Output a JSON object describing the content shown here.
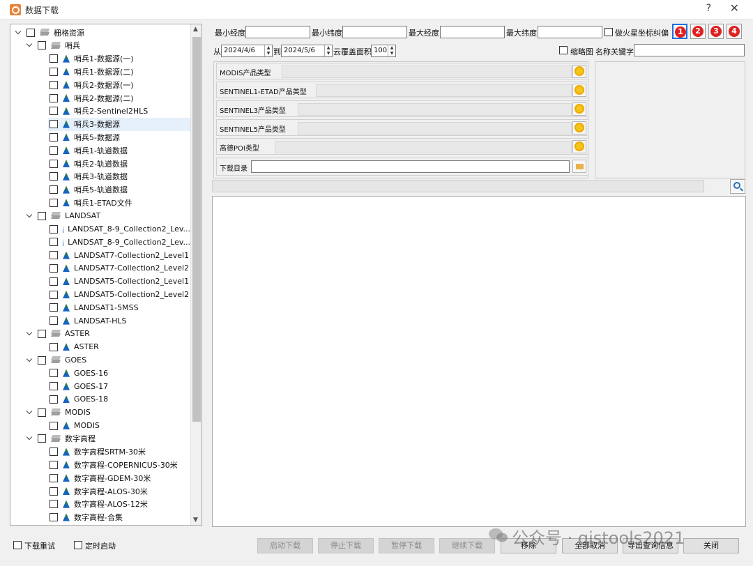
{
  "window": {
    "title": "数据下载",
    "help": "?",
    "close": "✕"
  },
  "tree": {
    "rows": [
      {
        "level": 0,
        "label": "栅格资源",
        "type": "group"
      },
      {
        "level": 1,
        "label": "哨兵",
        "type": "group"
      },
      {
        "level": 2,
        "label": "哨兵1-数据源(一)",
        "type": "leaf"
      },
      {
        "level": 2,
        "label": "哨兵1-数据源(二)",
        "type": "leaf"
      },
      {
        "level": 2,
        "label": "哨兵2-数据源(一)",
        "type": "leaf"
      },
      {
        "level": 2,
        "label": "哨兵2-数据源(二)",
        "type": "leaf"
      },
      {
        "level": 2,
        "label": "哨兵2-Sentinel2HLS",
        "type": "leaf"
      },
      {
        "level": 2,
        "label": "哨兵3-数据源",
        "type": "leaf",
        "selected": true
      },
      {
        "level": 2,
        "label": "哨兵5-数据源",
        "type": "leaf"
      },
      {
        "level": 2,
        "label": "哨兵1-轨道数据",
        "type": "leaf"
      },
      {
        "level": 2,
        "label": "哨兵2-轨道数据",
        "type": "leaf"
      },
      {
        "level": 2,
        "label": "哨兵3-轨道数据",
        "type": "leaf"
      },
      {
        "level": 2,
        "label": "哨兵5-轨道数据",
        "type": "leaf"
      },
      {
        "level": 2,
        "label": "哨兵1-ETAD文件",
        "type": "leaf"
      },
      {
        "level": 1,
        "label": "LANDSAT",
        "type": "group"
      },
      {
        "level": 2,
        "label": "LANDSAT_8-9_Collection2_Lev...",
        "type": "leaf"
      },
      {
        "level": 2,
        "label": "LANDSAT_8-9_Collection2_Lev...",
        "type": "leaf"
      },
      {
        "level": 2,
        "label": "LANDSAT7-Collection2_Level1",
        "type": "leaf"
      },
      {
        "level": 2,
        "label": "LANDSAT7-Collection2_Level2",
        "type": "leaf"
      },
      {
        "level": 2,
        "label": "LANDSAT5-Collection2_Level1",
        "type": "leaf"
      },
      {
        "level": 2,
        "label": "LANDSAT5-Collection2_Level2",
        "type": "leaf"
      },
      {
        "level": 2,
        "label": "LANDSAT1-5MSS",
        "type": "leaf"
      },
      {
        "level": 2,
        "label": "LANDSAT-HLS",
        "type": "leaf"
      },
      {
        "level": 1,
        "label": "ASTER",
        "type": "group"
      },
      {
        "level": 2,
        "label": "ASTER",
        "type": "leaf"
      },
      {
        "level": 1,
        "label": "GOES",
        "type": "group"
      },
      {
        "level": 2,
        "label": "GOES-16",
        "type": "leaf"
      },
      {
        "level": 2,
        "label": "GOES-17",
        "type": "leaf"
      },
      {
        "level": 2,
        "label": "GOES-18",
        "type": "leaf"
      },
      {
        "level": 1,
        "label": "MODIS",
        "type": "group"
      },
      {
        "level": 2,
        "label": "MODIS",
        "type": "leaf"
      },
      {
        "level": 1,
        "label": "数字高程",
        "type": "group"
      },
      {
        "level": 2,
        "label": "数字高程SRTM-30米",
        "type": "leaf"
      },
      {
        "level": 2,
        "label": "数字高程-COPERNICUS-30米",
        "type": "leaf"
      },
      {
        "level": 2,
        "label": "数字高程-GDEM-30米",
        "type": "leaf"
      },
      {
        "level": 2,
        "label": "数字高程-ALOS-30米",
        "type": "leaf"
      },
      {
        "level": 2,
        "label": "数字高程-ALOS-12米",
        "type": "leaf"
      },
      {
        "level": 2,
        "label": "数字高程-合集",
        "type": "leaf"
      }
    ]
  },
  "query": {
    "min_lon_label": "最小经度",
    "min_lat_label": "最小纬度",
    "max_lon_label": "最大经度",
    "max_lat_label": "最大纬度",
    "mars_coord_label": "做火星坐标纠偏",
    "from_label": "从",
    "from_date": "2024/4/6",
    "to_label": "到",
    "to_date": "2024/5/6",
    "cloud_label": "云覆盖面积",
    "cloud_value": "100",
    "thumbnail_label": "缩略图",
    "name_keyword_label": "名称关键字"
  },
  "number_buttons": [
    "1",
    "2",
    "3",
    "4"
  ],
  "products": [
    {
      "label": "MODIS产品类型"
    },
    {
      "label": "SENTINEL1-ETAD产品类型"
    },
    {
      "label": "SENTINEL3产品类型"
    },
    {
      "label": "SENTINEL5产品类型"
    },
    {
      "label": "高德POI类型"
    }
  ],
  "download_dir_label": "下载目录",
  "bottom": {
    "resume_label": "下载重试",
    "timer_label": "定时启动",
    "buttons": [
      "启动下载",
      "停止下载",
      "暂停下载",
      "继续下载",
      "移除",
      "全部取消",
      "导出查询信息",
      "关闭"
    ]
  },
  "watermark": "公众号 · gistools2021"
}
